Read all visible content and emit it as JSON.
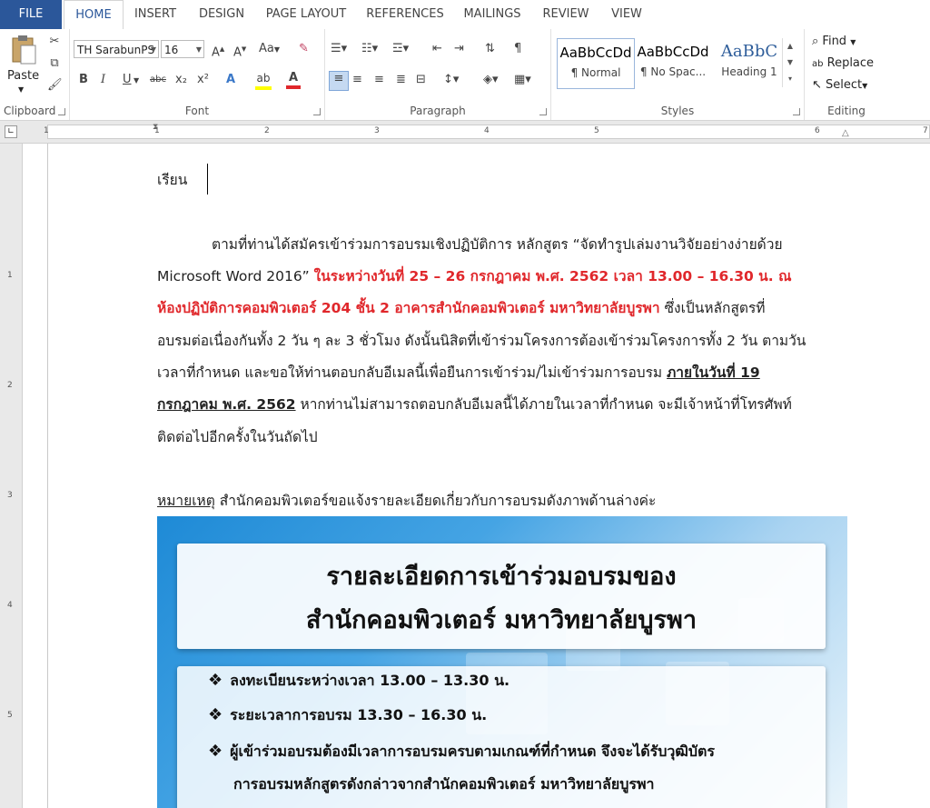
{
  "tabs": [
    "FILE",
    "HOME",
    "INSERT",
    "DESIGN",
    "PAGE LAYOUT",
    "REFERENCES",
    "MAILINGS",
    "REVIEW",
    "VIEW"
  ],
  "clipboard": {
    "paste": "Paste",
    "label": "Clipboard"
  },
  "font": {
    "name": "TH SarabunPS",
    "size": "16",
    "label": "Font",
    "case": "Aa",
    "bold": "B",
    "italic": "I",
    "underline": "U",
    "strike": "abc",
    "sub": "x₂",
    "sup": "x²"
  },
  "paragraph": {
    "label": "Paragraph",
    "pilcrow": "¶"
  },
  "styles": {
    "label": "Styles",
    "items": [
      {
        "preview": "AaBbCcDd",
        "name": "¶ Normal"
      },
      {
        "preview": "AaBbCcDd",
        "name": "¶ No Spac..."
      },
      {
        "preview": "AaBbC",
        "name": "Heading 1"
      }
    ]
  },
  "editing": {
    "label": "Editing",
    "find": "Find",
    "replace": "Replace",
    "select": "Select"
  },
  "ruler": {
    "h": [
      "1",
      "1",
      "2",
      "3",
      "4",
      "5",
      "6",
      "7"
    ],
    "v": [
      "1",
      "2",
      "3",
      "4",
      "5"
    ]
  },
  "colors": {
    "brand": "#2b579a",
    "highlight_red": "#e0272b"
  },
  "doc": {
    "salutation": "เรียน",
    "p1_l1": "ตามที่ท่านได้สมัครเข้าร่วมการอบรมเชิงปฏิบัติการ หลักสูตร “จัดทำรูปเล่มงานวิจัยอย่างง่ายด้วย",
    "p1_l2a": "Microsoft Word 2016” ",
    "p1_l2b": "ในระหว่างวันที่ 25 – 26 กรกฎาคม พ.ศ. 2562 เวลา 13.00 – 16.30 น. ณ",
    "p1_l3a": "ห้องปฏิบัติการคอมพิวเตอร์ 204 ชั้น 2 อาคารสำนักคอมพิวเตอร์ มหาวิทยาลัยบูรพา",
    "p1_l3b": " ซึ่งเป็นหลักสูตรที่",
    "p1_l4": "อบรมต่อเนื่องกันทั้ง 2 วัน ๆ ละ 3 ชั่วโมง ดังนั้นนิสิตที่เข้าร่วมโครงการต้องเข้าร่วมโครงการทั้ง 2 วัน ตามวัน",
    "p1_l5a": "เวลาที่กำหนด และขอให้ท่านตอบกลับอีเมลนี้เพื่อยืนการเข้าร่วม/ไม่เข้าร่วมการอบรม ",
    "p1_l5b": "ภายในวันที่ 19",
    "p1_l6a": "กรกฎาคม พ.ศ. 2562",
    "p1_l6b": " หากท่านไม่สามารถตอบกลับอีเมลนี้ได้ภายในเวลาที่กำหนด จะมีเจ้าหน้าที่โทรศัพท์",
    "p1_l7": "ติดต่อไปอีกครั้งในวันถัดไป",
    "note_label": "หมายเหตุ",
    "note_text": " สำนักคอมพิวเตอร์ขอแจ้งรายละเอียดเกี่ยวกับการอบรมดังภาพด้านล่างค่ะ"
  },
  "image": {
    "title1": "รายละเอียดการเข้าร่วมอบรมของ",
    "title2": "สำนักคอมพิวเตอร์ มหาวิทยาลัยบูรพา",
    "bullets": [
      "ลงทะเบียนระหว่างเวลา 13.00 – 13.30 น.",
      "ระยะเวลาการอบรม 13.30 – 16.30 น.",
      "ผู้เข้าร่วมอบรมต้องมีเวลาการอบรมครบตามเกณฑ์ที่กำหนด จึงจะได้รับวุฒิบัตร"
    ],
    "bullet3_cont": "การอบรมหลักสูตรดังกล่าวจากสำนักคอมพิวเตอร์ มหาวิทยาลัยบูรพา"
  }
}
